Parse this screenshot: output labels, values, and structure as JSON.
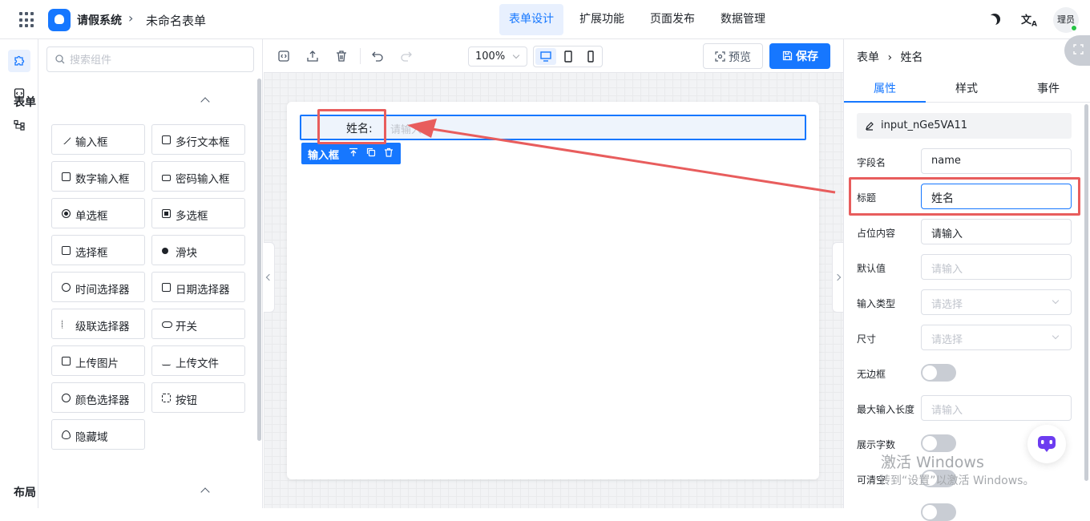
{
  "header": {
    "app_title": "请假系统",
    "breadcrumb_sep": "›",
    "form_name": "未命名表单",
    "tabs": [
      {
        "label": "表单设计",
        "active": true
      },
      {
        "label": "扩展功能",
        "active": false
      },
      {
        "label": "页面发布",
        "active": false
      },
      {
        "label": "数据管理",
        "active": false
      }
    ],
    "lang_icon": "translate-icon",
    "theme_icon": "moon-icon",
    "user": "理员"
  },
  "rail": {
    "items": [
      "puzzle-icon",
      "code-icon",
      "tree-icon"
    ]
  },
  "components": {
    "search_placeholder": "搜索组件",
    "form_section": "表单",
    "layout_section": "布局",
    "items": [
      {
        "label": "输入框",
        "icon": "pencil-icon"
      },
      {
        "label": "多行文本框",
        "icon": "textarea-icon"
      },
      {
        "label": "数字输入框",
        "icon": "number-icon"
      },
      {
        "label": "密码输入框",
        "icon": "lock-icon"
      },
      {
        "label": "单选框",
        "icon": "radio-icon"
      },
      {
        "label": "多选框",
        "icon": "checkbox-icon"
      },
      {
        "label": "选择框",
        "icon": "select-icon"
      },
      {
        "label": "滑块",
        "icon": "slider-icon"
      },
      {
        "label": "时间选择器",
        "icon": "clock-icon"
      },
      {
        "label": "日期选择器",
        "icon": "calendar-icon"
      },
      {
        "label": "级联选择器",
        "icon": "cascader-icon"
      },
      {
        "label": "开关",
        "icon": "switch-icon"
      },
      {
        "label": "上传图片",
        "icon": "image-icon"
      },
      {
        "label": "上传文件",
        "icon": "upload-icon"
      },
      {
        "label": "颜色选择器",
        "icon": "palette-icon"
      },
      {
        "label": "按钮",
        "icon": "button-icon"
      },
      {
        "label": "隐藏域",
        "icon": "eye-off-icon"
      }
    ]
  },
  "toolbar": {
    "zoom": "100%",
    "preview_label": "预览",
    "save_label": "保存"
  },
  "canvas": {
    "field_label": "姓名:",
    "field_placeholder": "请输入",
    "selected_type": "输入框"
  },
  "props": {
    "crumb_form": "表单",
    "crumb_sep": "›",
    "crumb_field": "姓名",
    "tabs": [
      "属性",
      "样式",
      "事件"
    ],
    "id": "input_nGe5VA11",
    "rows": [
      {
        "label": "字段名",
        "value": "name",
        "placeholder": false
      },
      {
        "label": "标题",
        "value": "姓名",
        "placeholder": false
      },
      {
        "label": "占位内容",
        "value": "请输入",
        "placeholder": false
      },
      {
        "label": "默认值",
        "value": "请输入",
        "placeholder": true
      },
      {
        "label": "输入类型",
        "value": "请选择",
        "placeholder": true
      },
      {
        "label": "尺寸",
        "value": "请选择",
        "placeholder": true
      },
      {
        "label": "无边框",
        "value": "",
        "placeholder": false
      },
      {
        "label": "最大输入长度",
        "value": "请输入",
        "placeholder": true
      },
      {
        "label": "展示字数",
        "value": "",
        "placeholder": false
      },
      {
        "label": "可清空",
        "value": "",
        "placeholder": false
      }
    ]
  },
  "watermark": {
    "line1": "激活 Windows",
    "line2": "转到“设置”以激活 Windows。"
  },
  "colors": {
    "accent": "#1677ff",
    "annotation_red": "#e85d5d"
  }
}
